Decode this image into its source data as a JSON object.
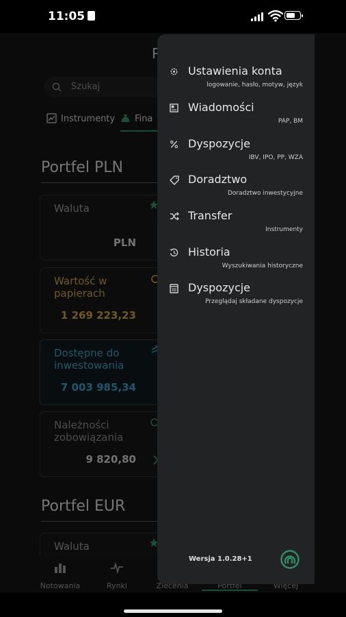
{
  "status_bar": {
    "time": "11:05"
  },
  "header": {
    "title_partial": "P"
  },
  "search": {
    "placeholder": "Szukaj"
  },
  "tabs": [
    {
      "label": "Instrumenty"
    },
    {
      "label": "Fina"
    }
  ],
  "sections": [
    {
      "title": "Portfel PLN"
    },
    {
      "title": "Portfel EUR"
    }
  ],
  "cards": [
    {
      "label_line1": "Waluta",
      "label_line2": "",
      "value": "PLN",
      "color": "#9a9a9a"
    },
    {
      "label_line1": "Wartość w",
      "label_line2": "papierach",
      "value": "1 269 223,23",
      "color": "#c9a23a"
    },
    {
      "label_line1": "Dostępne do",
      "label_line2": "inwestowania",
      "value": "7 003 985,34",
      "color": "#3a9ec2"
    },
    {
      "label_line1": "Należności",
      "label_line2": "zobowiązania",
      "value": "9 820,80",
      "color": "#8a8a8a"
    },
    {
      "label_line1": "Waluta",
      "label_line2": "",
      "value": "",
      "color": "#9a9a9a"
    }
  ],
  "bottom_nav": [
    {
      "label": "Notowania",
      "icon": "bar-chart-icon"
    },
    {
      "label": "Rynki",
      "icon": "pulse-icon"
    },
    {
      "label": "Zlecenia",
      "icon": "orders-icon"
    },
    {
      "label": "Portfel",
      "icon": "wallet-icon",
      "active": true
    },
    {
      "label": "Więcej",
      "icon": "more-icon"
    }
  ],
  "drawer": {
    "items": [
      {
        "title": "Ustawienia konta",
        "subtitle": "logowanie, hasło, motyw, język",
        "icon": "gear-icon"
      },
      {
        "title": "Wiadomości",
        "subtitle": "PAP, BM",
        "icon": "newspaper-icon"
      },
      {
        "title": "Dyspozycje",
        "subtitle": "IBV, IPO, PP, WZA",
        "icon": "percent-icon"
      },
      {
        "title": "Doradztwo",
        "subtitle": "Doradztwo inwestycyjne",
        "icon": "tag-icon"
      },
      {
        "title": "Transfer",
        "subtitle": "Instrumenty",
        "icon": "shuffle-icon"
      },
      {
        "title": "Historia",
        "subtitle": "Wyszukiwania historyczne",
        "icon": "history-icon"
      },
      {
        "title": "Dyspozycje",
        "subtitle": "Przeglądaj składane dyspozycje",
        "icon": "document-icon"
      }
    ],
    "version": "Wersja 1.0.28+1"
  },
  "colors": {
    "accent": "#2f8f66",
    "drawer_bg": "#222324",
    "gold": "#c9a23a",
    "blue": "#3a9ec2"
  }
}
